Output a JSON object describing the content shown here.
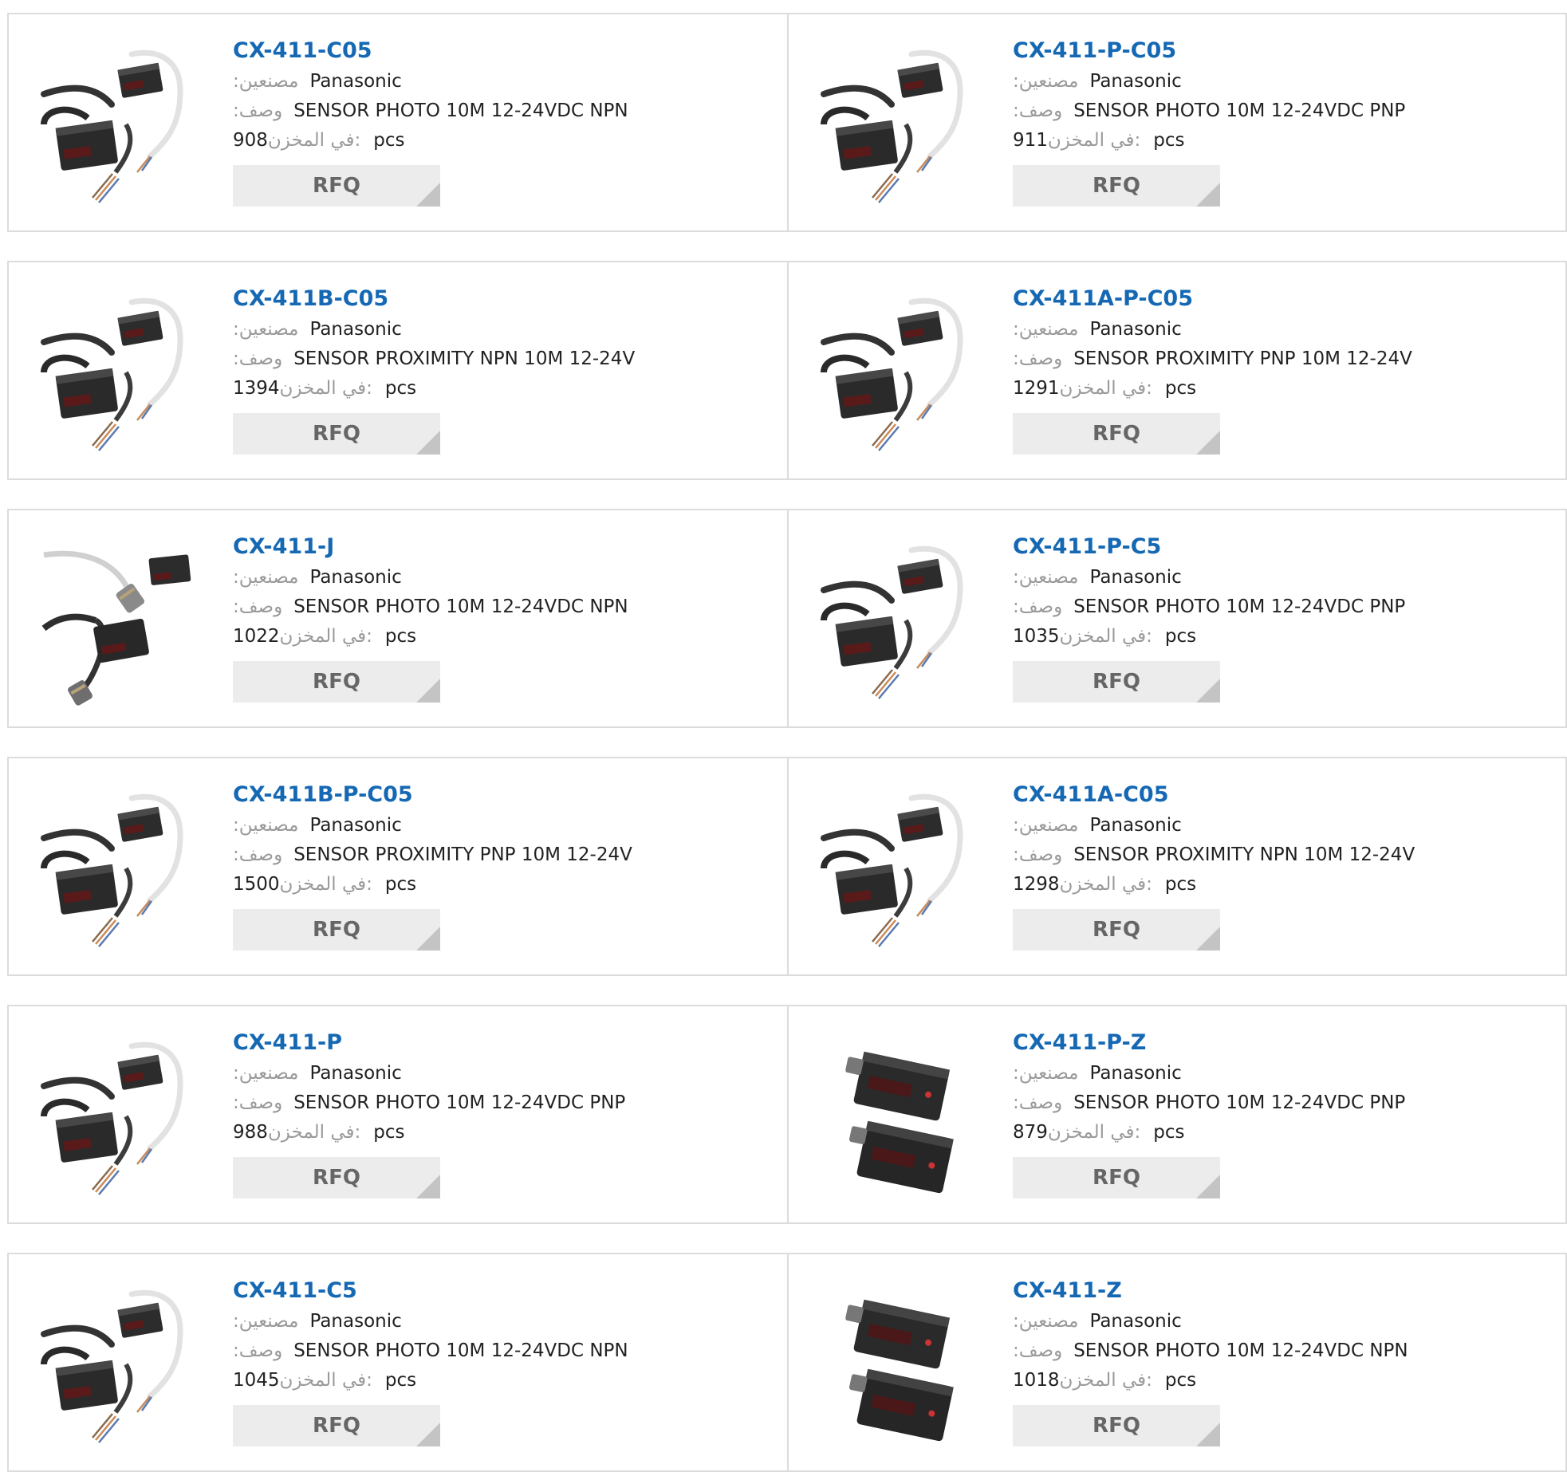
{
  "labels": {
    "manufacturer": ":مصنعين",
    "description": ":وصف",
    "stock": "في المخزن:",
    "unit": "pcs",
    "rfq": "RFQ"
  },
  "products": [
    {
      "pn": "CX-411-C05",
      "mfr": "Panasonic",
      "desc": "SENSOR PHOTO 10M 12-24VDC NPN",
      "stock": "908",
      "image": "sensor-cable-icon"
    },
    {
      "pn": "CX-411-P-C05",
      "mfr": "Panasonic",
      "desc": "SENSOR PHOTO 10M 12-24VDC PNP",
      "stock": "911",
      "image": "sensor-cable-icon"
    },
    {
      "pn": "CX-411B-C05",
      "mfr": "Panasonic",
      "desc": "SENSOR PROXIMITY NPN 10M 12-24V",
      "stock": "1394",
      "image": "sensor-cable-icon"
    },
    {
      "pn": "CX-411A-P-C05",
      "mfr": "Panasonic",
      "desc": "SENSOR PROXIMITY PNP 10M 12-24V",
      "stock": "1291",
      "image": "sensor-cable-icon"
    },
    {
      "pn": "CX-411-J",
      "mfr": "Panasonic",
      "desc": "SENSOR PHOTO 10M 12-24VDC NPN",
      "stock": "1022",
      "image": "sensor-connector-icon"
    },
    {
      "pn": "CX-411-P-C5",
      "mfr": "Panasonic",
      "desc": "SENSOR PHOTO 10M 12-24VDC PNP",
      "stock": "1035",
      "image": "sensor-cable-icon"
    },
    {
      "pn": "CX-411B-P-C05",
      "mfr": "Panasonic",
      "desc": "SENSOR PROXIMITY PNP 10M 12-24V",
      "stock": "1500",
      "image": "sensor-cable-icon"
    },
    {
      "pn": "CX-411A-C05",
      "mfr": "Panasonic",
      "desc": "SENSOR PROXIMITY NPN 10M 12-24V",
      "stock": "1298",
      "image": "sensor-cable-icon"
    },
    {
      "pn": "CX-411-P",
      "mfr": "Panasonic",
      "desc": "SENSOR PHOTO 10M 12-24VDC PNP",
      "stock": "988",
      "image": "sensor-cable-icon"
    },
    {
      "pn": "CX-411-P-Z",
      "mfr": "Panasonic",
      "desc": "SENSOR PHOTO 10M 12-24VDC PNP",
      "stock": "879",
      "image": "sensor-body-icon"
    },
    {
      "pn": "CX-411-C5",
      "mfr": "Panasonic",
      "desc": "SENSOR PHOTO 10M 12-24VDC NPN",
      "stock": "1045",
      "image": "sensor-cable-icon"
    },
    {
      "pn": "CX-411-Z",
      "mfr": "Panasonic",
      "desc": "SENSOR PHOTO 10M 12-24VDC NPN",
      "stock": "1018",
      "image": "sensor-body-icon"
    }
  ]
}
